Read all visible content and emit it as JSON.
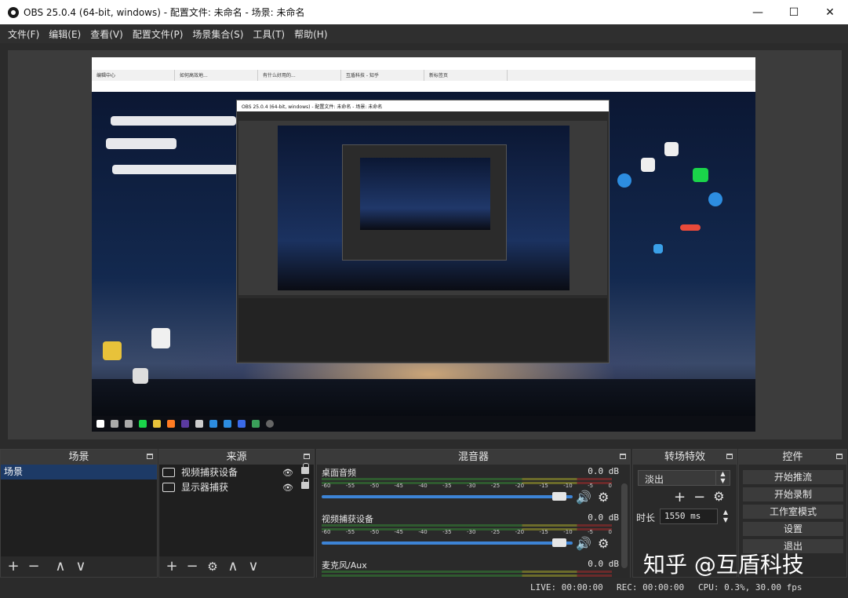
{
  "window": {
    "title": "OBS 25.0.4 (64-bit, windows) - 配置文件: 未命名 - 场景: 未命名",
    "minimize": "—",
    "maximize": "☐",
    "close": "✕"
  },
  "menu": [
    "文件(F)",
    "编辑(E)",
    "查看(V)",
    "配置文件(P)",
    "场景集合(S)",
    "工具(T)",
    "帮助(H)"
  ],
  "preview": {
    "browser_tabs": [
      "编辑中心",
      "如何高效地...",
      "有什么好用的...",
      "互盾科技 - 知乎",
      "新标签页"
    ],
    "inner_title": "OBS 25.0.4 (64-bit, windows) - 配置文件: 未命名 - 场景: 未命名"
  },
  "scenes": {
    "title": "场景",
    "items": [
      "场景"
    ],
    "toolbar": {
      "add": "+",
      "remove": "−",
      "up": "∧",
      "down": "∨"
    }
  },
  "sources": {
    "title": "来源",
    "items": [
      {
        "label": "视频捕获设备",
        "icon": "camera-icon"
      },
      {
        "label": "显示器捕获",
        "icon": "monitor-icon"
      }
    ],
    "toolbar": {
      "add": "+",
      "remove": "−",
      "settings": "⚙",
      "up": "∧",
      "down": "∨"
    }
  },
  "mixer": {
    "title": "混音器",
    "ticks": [
      "-60",
      "-55",
      "-50",
      "-45",
      "-40",
      "-35",
      "-30",
      "-25",
      "-20",
      "-15",
      "-10",
      "-5",
      "0"
    ],
    "channels": [
      {
        "name": "桌面音频",
        "db": "0.0 dB",
        "volume_percent": 100
      },
      {
        "name": "视频捕获设备",
        "db": "0.0 dB",
        "volume_percent": 100
      },
      {
        "name": "麦克风/Aux",
        "db": "0.0 dB",
        "volume_percent": 100
      }
    ]
  },
  "transitions": {
    "title": "转场特效",
    "selected": "淡出",
    "add": "+",
    "remove": "−",
    "settings": "⚙",
    "duration_label": "时长",
    "duration_value": "1550 ms"
  },
  "controls": {
    "title": "控件",
    "buttons": [
      "开始推流",
      "开始录制",
      "工作室模式",
      "设置",
      "退出"
    ]
  },
  "status": {
    "live": "LIVE: 00:00:00",
    "rec": "REC: 00:00:00",
    "cpu": "CPU: 0.3%, 30.00 fps"
  },
  "watermark": "知乎 @互盾科技",
  "colors": {
    "accent": "#3d84d6",
    "selected_row": "#1d3a66",
    "panel_bg": "#2a2a2a"
  }
}
